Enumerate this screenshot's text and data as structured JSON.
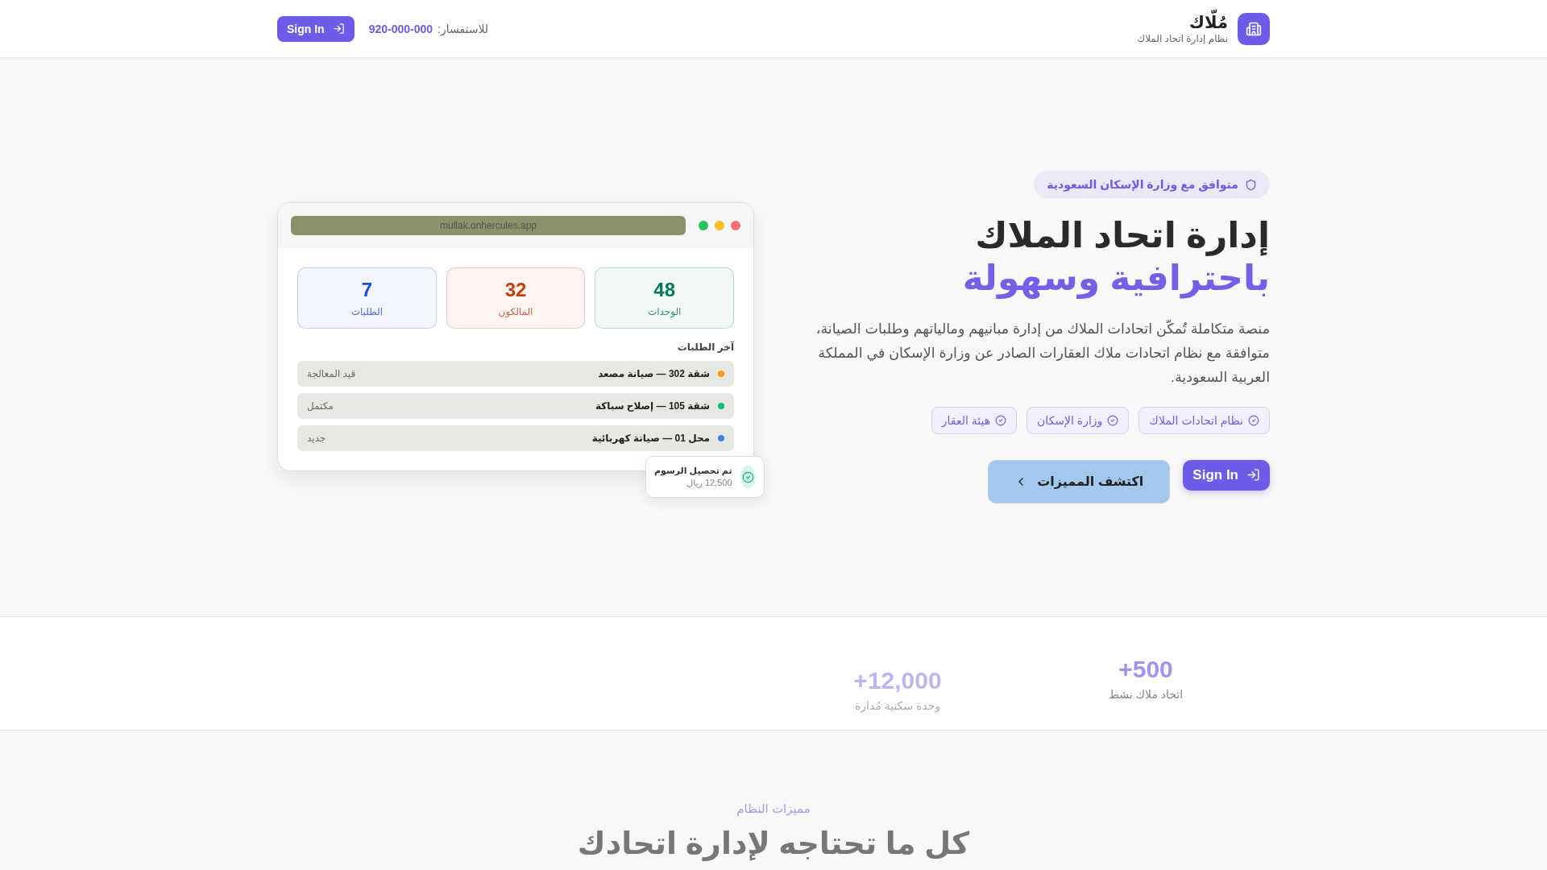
{
  "header": {
    "logo": {
      "title": "مُلّاك",
      "subtitle": "نظام إدارة اتحاد الملاك"
    },
    "contact": {
      "label": "للاستفسار:",
      "phone": "920-000-000"
    },
    "sign_in": "Sign In"
  },
  "hero": {
    "badge": "متوافق مع وزارة الإسكان السعودية",
    "title_line1": "إدارة اتحاد الملاك",
    "title_line2": "باحترافية وسهولة",
    "description": "منصة متكاملة تُمكّن اتحادات الملاك من إدارة مبانيهم ومالياتهم وطلبات الصيانة، متوافقة مع نظام اتحادات ملاك العقارات الصادر عن وزارة الإسكان في المملكة العربية السعودية.",
    "tags": [
      "نظام اتحادات الملاك",
      "وزارة الإسكان",
      "هيئة العقار"
    ],
    "sign_in": "Sign In",
    "explore": "اكتشف المميزات"
  },
  "mockup": {
    "url": "mullak.onhercules.app",
    "stats": [
      {
        "value": "48",
        "label": "الوحدات",
        "color": "#047857"
      },
      {
        "value": "32",
        "label": "المالكون",
        "color": "#c2410c"
      },
      {
        "value": "7",
        "label": "الطلبات",
        "color": "#1d4ed8"
      }
    ],
    "section_title": "آخر الطلبات",
    "requests": [
      {
        "title": "شقة 302 — صيانة مصعد",
        "status": "قيد المعالجة",
        "color": "#f59e0b"
      },
      {
        "title": "شقة 105 — إصلاح سباكة",
        "status": "مكتمل",
        "color": "#10b981"
      },
      {
        "title": "محل 01 — صيانة كهربائية",
        "status": "جديد",
        "color": "#3b82f6"
      }
    ],
    "toast": {
      "title": "تم تحصيل الرسوم",
      "amount": "12,500 ريال"
    }
  },
  "stats": [
    {
      "value": "+500",
      "label": "اتحاد ملاك نشط"
    },
    {
      "value": "+12,000",
      "label": "وحدة سكنية مُدارة"
    }
  ],
  "features": {
    "eyebrow": "مميزات النظام",
    "title": "كل ما تحتاجه لإدارة اتحادك"
  }
}
